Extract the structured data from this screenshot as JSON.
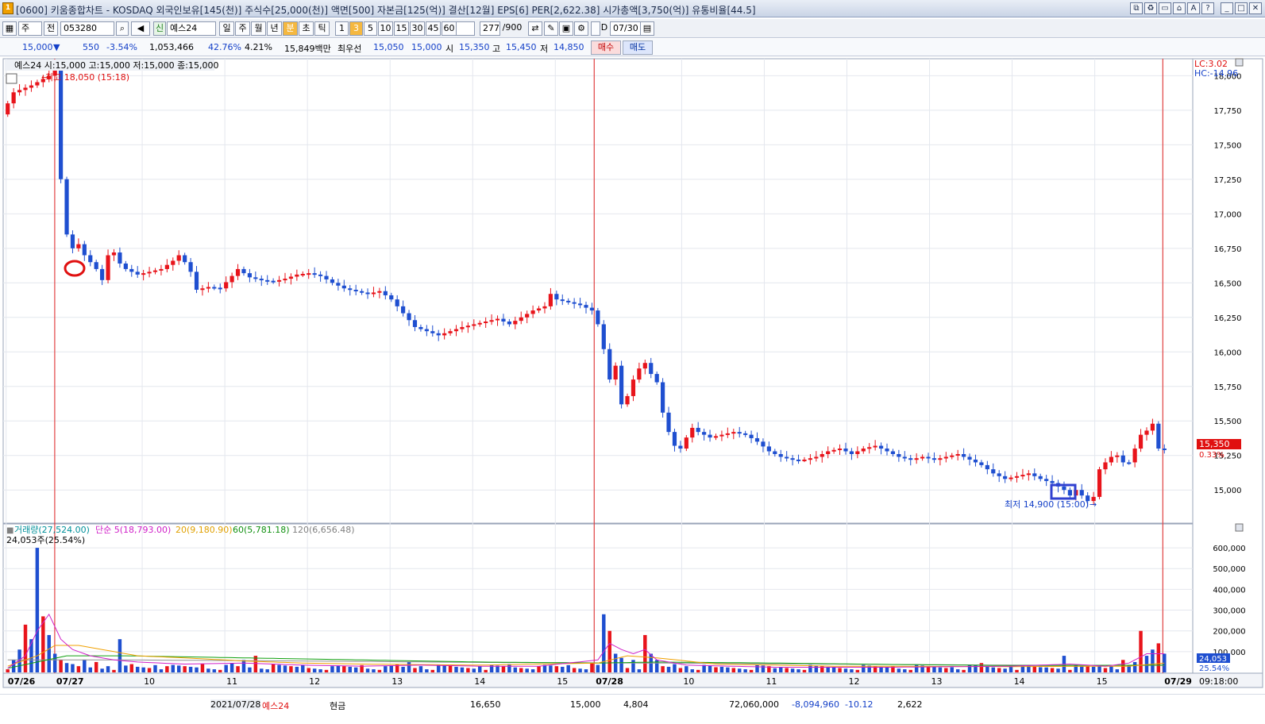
{
  "window": {
    "title": "[0600] 키움종합차트 - KOSDAQ 외국인보유[145(천)] 주식수[25,000(천)] 액면[500] 자본금[125(억)] 결산[12월] EPS[6] PER[2,622.38] 시가총액[3,750(억)] 유통비율[44.5]",
    "app_icon": "1"
  },
  "toolbar": {
    "type_select": "주",
    "jeon_label": "전",
    "code": "053280",
    "new_label": "신",
    "stock_name": "예스24",
    "period_buttons": [
      "일",
      "주",
      "월",
      "년",
      "분",
      "초",
      "틱"
    ],
    "interval_buttons": [
      "1",
      "3",
      "5",
      "10",
      "15",
      "30",
      "45",
      "60"
    ],
    "interval_select": "3",
    "count": "277",
    "count_max": "/900",
    "date": "07/30",
    "checkbox_label": "D"
  },
  "quote": {
    "price": "15,000",
    "change": "550",
    "change_pct": "-3.54%",
    "volume": "1,053,466",
    "ratio": "42.76%",
    "turnover": "4.21%",
    "amount": "15,849백만",
    "best_label": "최우선",
    "best_ask": "15,050",
    "best_bid": "15,000",
    "open_label": "시",
    "open": "15,350",
    "high_label": "고",
    "high": "15,450",
    "low_label": "저",
    "low": "14,850",
    "buy_button": "매수",
    "sell_button": "매도"
  },
  "chart": {
    "info": "예스24 시:15,000 고:15,000 저:15,000 종:15,000",
    "high_marker": "최고 18,050 (15:18)",
    "low_marker": "최저 14,900 (15:00)",
    "lc": "LC:3.02",
    "hc": "HC:-14.96",
    "current_price": "15,350",
    "current_pct": "0.33%",
    "volume_legend": {
      "volume": "거래량(27,524.00)",
      "ma5": "단순 5(18,793.00)",
      "ma20": "20(9,180.90)",
      "ma60": "60(5,781.18)",
      "ma120": "120(6,656.48)",
      "cursor": "24,053주(25.54%)"
    },
    "volume_current": "24,053",
    "volume_current_pct": "25.54%",
    "time_readout": "09:18:00",
    "x_labels": [
      "07/26",
      "07/27",
      "10",
      "11",
      "12",
      "13",
      "14",
      "15",
      "07/28",
      "10",
      "11",
      "12",
      "13",
      "14",
      "15",
      "07/29"
    ],
    "colors": {
      "up": "#e8141b",
      "down": "#1f4fd0",
      "ma5": "#d020c8",
      "ma20": "#f0a000",
      "ma60": "#10a010",
      "ma120": "#909090",
      "day_line": "#e02020"
    }
  },
  "chart_data": {
    "type": "candlestick",
    "price_axis": {
      "ticks": [
        "15,000",
        "15,250",
        "15,500",
        "15,750",
        "16,000",
        "16,250",
        "16,500",
        "16,750",
        "17,000",
        "17,250",
        "17,500",
        "17,750",
        "18,000"
      ],
      "range": [
        14800,
        18100
      ]
    },
    "volume_axis": {
      "ticks": [
        "100,000",
        "200,000",
        "300,000",
        "400,000",
        "500,000",
        "600,000"
      ],
      "range": [
        0,
        650000
      ]
    },
    "price_path": [
      [
        0,
        17720
      ],
      [
        2,
        17880
      ],
      [
        5,
        17930
      ],
      [
        8,
        18000
      ],
      [
        9,
        18050
      ],
      [
        10,
        17250
      ],
      [
        11,
        16850
      ],
      [
        12,
        16750
      ],
      [
        13,
        16780
      ],
      [
        14,
        16700
      ],
      [
        15,
        16650
      ],
      [
        16,
        16600
      ],
      [
        17,
        16520
      ],
      [
        18,
        16700
      ],
      [
        19,
        16720
      ],
      [
        20,
        16640
      ],
      [
        21,
        16600
      ],
      [
        22,
        16580
      ],
      [
        23,
        16560
      ],
      [
        25,
        16580
      ],
      [
        27,
        16600
      ],
      [
        29,
        16660
      ],
      [
        30,
        16700
      ],
      [
        31,
        16650
      ],
      [
        32,
        16580
      ],
      [
        33,
        16450
      ],
      [
        35,
        16470
      ],
      [
        37,
        16460
      ],
      [
        39,
        16550
      ],
      [
        40,
        16600
      ],
      [
        42,
        16540
      ],
      [
        44,
        16520
      ],
      [
        46,
        16510
      ],
      [
        48,
        16530
      ],
      [
        50,
        16560
      ],
      [
        52,
        16570
      ],
      [
        54,
        16550
      ],
      [
        56,
        16500
      ],
      [
        58,
        16460
      ],
      [
        60,
        16440
      ],
      [
        62,
        16420
      ],
      [
        64,
        16440
      ],
      [
        66,
        16380
      ],
      [
        68,
        16280
      ],
      [
        70,
        16180
      ],
      [
        72,
        16150
      ],
      [
        74,
        16120
      ],
      [
        76,
        16150
      ],
      [
        78,
        16180
      ],
      [
        80,
        16200
      ],
      [
        82,
        16220
      ],
      [
        84,
        16240
      ],
      [
        86,
        16200
      ],
      [
        88,
        16250
      ],
      [
        90,
        16300
      ],
      [
        92,
        16330
      ],
      [
        93,
        16420
      ],
      [
        94,
        16380
      ],
      [
        96,
        16360
      ],
      [
        98,
        16340
      ],
      [
        100,
        16300
      ],
      [
        101,
        16200
      ],
      [
        102,
        16020
      ],
      [
        103,
        15800
      ],
      [
        104,
        15900
      ],
      [
        105,
        15620
      ],
      [
        106,
        15680
      ],
      [
        107,
        15800
      ],
      [
        108,
        15880
      ],
      [
        109,
        15920
      ],
      [
        110,
        15840
      ],
      [
        111,
        15780
      ],
      [
        112,
        15560
      ],
      [
        113,
        15420
      ],
      [
        114,
        15320
      ],
      [
        115,
        15300
      ],
      [
        116,
        15380
      ],
      [
        117,
        15450
      ],
      [
        118,
        15420
      ],
      [
        120,
        15380
      ],
      [
        122,
        15400
      ],
      [
        124,
        15420
      ],
      [
        126,
        15400
      ],
      [
        128,
        15350
      ],
      [
        130,
        15280
      ],
      [
        132,
        15240
      ],
      [
        134,
        15220
      ],
      [
        136,
        15220
      ],
      [
        138,
        15240
      ],
      [
        140,
        15280
      ],
      [
        142,
        15300
      ],
      [
        144,
        15260
      ],
      [
        146,
        15300
      ],
      [
        148,
        15320
      ],
      [
        150,
        15280
      ],
      [
        152,
        15240
      ],
      [
        154,
        15220
      ],
      [
        156,
        15240
      ],
      [
        158,
        15220
      ],
      [
        160,
        15240
      ],
      [
        162,
        15260
      ],
      [
        164,
        15220
      ],
      [
        166,
        15180
      ],
      [
        168,
        15120
      ],
      [
        170,
        15080
      ],
      [
        172,
        15100
      ],
      [
        174,
        15120
      ],
      [
        176,
        15080
      ],
      [
        178,
        15050
      ],
      [
        180,
        15000
      ],
      [
        181,
        14960
      ],
      [
        182,
        15000
      ],
      [
        184,
        14920
      ],
      [
        185,
        14950
      ],
      [
        186,
        15150
      ],
      [
        187,
        15200
      ],
      [
        188,
        15240
      ],
      [
        189,
        15250
      ],
      [
        190,
        15200
      ],
      [
        191,
        15200
      ],
      [
        192,
        15300
      ],
      [
        193,
        15400
      ],
      [
        194,
        15430
      ],
      [
        195,
        15480
      ],
      [
        196,
        15300
      ]
    ],
    "volume_bars": [
      [
        0,
        15000
      ],
      [
        1,
        60000
      ],
      [
        2,
        110000
      ],
      [
        3,
        230000
      ],
      [
        4,
        160000
      ],
      [
        5,
        600000
      ],
      [
        6,
        270000
      ],
      [
        7,
        180000
      ],
      [
        8,
        90000
      ],
      [
        9,
        60000
      ],
      [
        10,
        45000
      ],
      [
        11,
        40000
      ],
      [
        13,
        60000
      ],
      [
        15,
        50000
      ],
      [
        17,
        30000
      ],
      [
        19,
        160000
      ],
      [
        21,
        40000
      ],
      [
        25,
        35000
      ],
      [
        27,
        30000
      ],
      [
        33,
        40000
      ],
      [
        38,
        45000
      ],
      [
        40,
        60000
      ],
      [
        42,
        80000
      ],
      [
        45,
        40000
      ],
      [
        50,
        35000
      ],
      [
        55,
        30000
      ],
      [
        60,
        35000
      ],
      [
        64,
        30000
      ],
      [
        66,
        40000
      ],
      [
        68,
        50000
      ],
      [
        70,
        30000
      ],
      [
        75,
        35000
      ],
      [
        80,
        30000
      ],
      [
        85,
        40000
      ],
      [
        90,
        30000
      ],
      [
        95,
        35000
      ],
      [
        99,
        45000
      ],
      [
        101,
        280000
      ],
      [
        102,
        200000
      ],
      [
        103,
        90000
      ],
      [
        104,
        70000
      ],
      [
        106,
        60000
      ],
      [
        108,
        180000
      ],
      [
        109,
        90000
      ],
      [
        110,
        60000
      ],
      [
        113,
        40000
      ],
      [
        115,
        30000
      ],
      [
        120,
        25000
      ],
      [
        130,
        20000
      ],
      [
        140,
        25000
      ],
      [
        150,
        30000
      ],
      [
        160,
        25000
      ],
      [
        165,
        45000
      ],
      [
        170,
        30000
      ],
      [
        175,
        25000
      ],
      [
        179,
        80000
      ],
      [
        182,
        30000
      ],
      [
        185,
        35000
      ],
      [
        187,
        30000
      ],
      [
        189,
        60000
      ],
      [
        191,
        50000
      ],
      [
        192,
        200000
      ],
      [
        193,
        80000
      ],
      [
        194,
        110000
      ],
      [
        195,
        140000
      ],
      [
        196,
        90000
      ]
    ],
    "ma5_path": [
      [
        0,
        20000
      ],
      [
        3,
        80000
      ],
      [
        5,
        200000
      ],
      [
        7,
        280000
      ],
      [
        9,
        160000
      ],
      [
        11,
        110000
      ],
      [
        14,
        80000
      ],
      [
        18,
        60000
      ],
      [
        22,
        50000
      ],
      [
        30,
        40000
      ],
      [
        40,
        45000
      ],
      [
        50,
        35000
      ],
      [
        60,
        30000
      ],
      [
        70,
        35000
      ],
      [
        80,
        30000
      ],
      [
        90,
        30000
      ],
      [
        100,
        60000
      ],
      [
        102,
        140000
      ],
      [
        104,
        110000
      ],
      [
        106,
        90000
      ],
      [
        108,
        110000
      ],
      [
        110,
        60000
      ],
      [
        115,
        35000
      ],
      [
        130,
        25000
      ],
      [
        150,
        25000
      ],
      [
        170,
        30000
      ],
      [
        180,
        40000
      ],
      [
        186,
        30000
      ],
      [
        190,
        45000
      ],
      [
        193,
        90000
      ],
      [
        196,
        90000
      ]
    ],
    "ma20_path": [
      [
        0,
        30000
      ],
      [
        5,
        80000
      ],
      [
        8,
        130000
      ],
      [
        12,
        130000
      ],
      [
        16,
        110000
      ],
      [
        22,
        80000
      ],
      [
        30,
        70000
      ],
      [
        40,
        55000
      ],
      [
        50,
        45000
      ],
      [
        60,
        40000
      ],
      [
        80,
        35000
      ],
      [
        100,
        45000
      ],
      [
        105,
        80000
      ],
      [
        110,
        70000
      ],
      [
        120,
        40000
      ],
      [
        140,
        30000
      ],
      [
        170,
        28000
      ],
      [
        190,
        30000
      ],
      [
        196,
        45000
      ]
    ],
    "ma60_path": [
      [
        0,
        20000
      ],
      [
        10,
        80000
      ],
      [
        20,
        80000
      ],
      [
        40,
        70000
      ],
      [
        60,
        60000
      ],
      [
        80,
        50000
      ],
      [
        100,
        45000
      ],
      [
        110,
        50000
      ],
      [
        130,
        45000
      ],
      [
        150,
        38000
      ],
      [
        170,
        33000
      ],
      [
        196,
        35000
      ]
    ],
    "ma120_path": [
      [
        0,
        60000
      ],
      [
        20,
        60000
      ],
      [
        50,
        55000
      ],
      [
        80,
        48000
      ],
      [
        110,
        45000
      ],
      [
        140,
        40000
      ],
      [
        170,
        35000
      ],
      [
        196,
        34000
      ]
    ]
  },
  "footer": {
    "date": "2021/07/28",
    "name": "예스24",
    "account": "현금",
    "v1": "16,650",
    "v2": "15,000",
    "v3": "4,804",
    "v4": "72,060,000",
    "v5": "-8,094,960",
    "v6": "-10.12",
    "v7": "2,622"
  }
}
